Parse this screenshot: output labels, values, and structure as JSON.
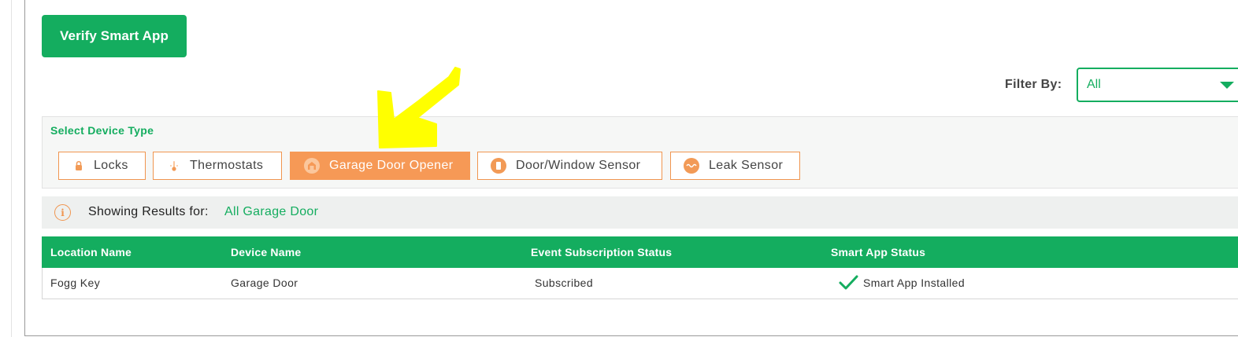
{
  "actions": {
    "verify_label": "Verify Smart App"
  },
  "filter": {
    "label": "Filter By:",
    "selected": "All"
  },
  "device_type": {
    "title": "Select Device Type",
    "buttons": [
      {
        "label": "Locks",
        "icon": "lock-icon",
        "active": false
      },
      {
        "label": "Thermostats",
        "icon": "thermostat-icon",
        "active": false
      },
      {
        "label": "Garage Door Opener",
        "icon": "garage-icon",
        "active": true
      },
      {
        "label": "Door/Window Sensor",
        "icon": "door-sensor-icon",
        "active": false
      },
      {
        "label": "Leak Sensor",
        "icon": "leak-sensor-icon",
        "active": false
      }
    ]
  },
  "results": {
    "label": "Showing Results for:",
    "value": "All Garage Door"
  },
  "table": {
    "headers": [
      "Location Name",
      "Device Name",
      "Event Subscription Status",
      "Smart App Status"
    ],
    "rows": [
      [
        "Fogg Key",
        "Garage Door",
        "Subscribed",
        "Smart App Installed"
      ]
    ]
  },
  "colors": {
    "accent": "#14ad5f",
    "orange": "#f69956",
    "highlight": "#ffff00"
  }
}
